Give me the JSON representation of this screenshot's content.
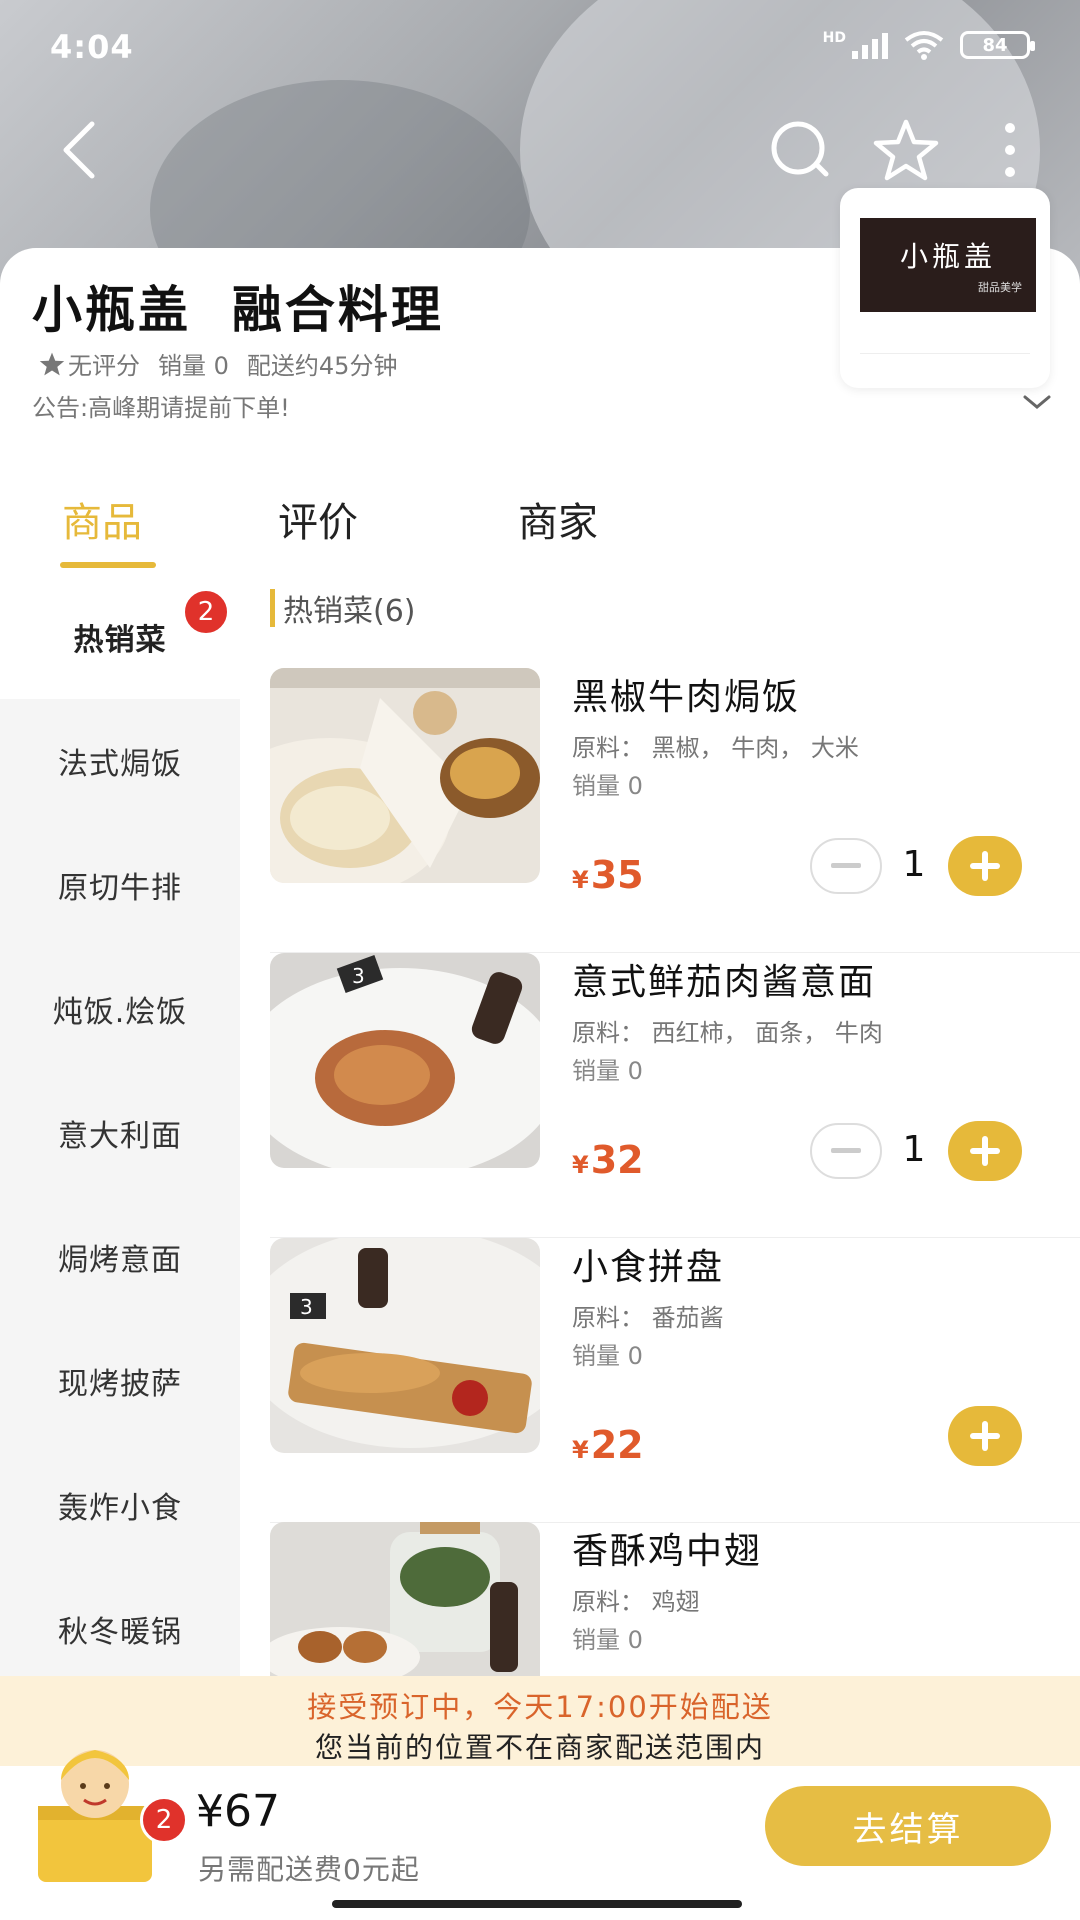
{
  "status_bar": {
    "time": "4:04",
    "network": "HD",
    "battery": "84"
  },
  "nav": {
    "back_icon": "chevron-left-icon",
    "search_icon": "search-icon",
    "favorite_icon": "star-icon",
    "more_icon": "more-vertical-icon"
  },
  "shop": {
    "logo_text": "小瓶盖",
    "logo_subtext": "甜品美学",
    "title": "小瓶盖  融合料理",
    "rating": "无评分",
    "sales": "销量 0",
    "delivery_time": "配送约45分钟",
    "notice": "公告:高峰期请提前下单!"
  },
  "tabs": [
    {
      "label": "商品",
      "active": true
    },
    {
      "label": "评价",
      "active": false
    },
    {
      "label": "商家",
      "active": false
    }
  ],
  "sidebar": {
    "badge": "2",
    "items": [
      {
        "label": "热销菜",
        "active": true
      },
      {
        "label": "法式焗饭",
        "active": false
      },
      {
        "label": "原切牛排",
        "active": false
      },
      {
        "label": "炖饭.烩饭",
        "active": false
      },
      {
        "label": "意大利面",
        "active": false
      },
      {
        "label": "焗烤意面",
        "active": false
      },
      {
        "label": "现烤披萨",
        "active": false
      },
      {
        "label": "轰炸小食",
        "active": false
      },
      {
        "label": "秋冬暖锅",
        "active": false
      }
    ]
  },
  "section": {
    "title": "热销菜(6)"
  },
  "products": [
    {
      "name": "黑椒牛肉焗饭",
      "ingredients": "原料： 黑椒， 牛肉， 大米",
      "sales": "销量 0",
      "currency": "¥",
      "price": "35",
      "quantity": "1"
    },
    {
      "name": "意式鲜茄肉酱意面",
      "ingredients": "原料： 西红柿， 面条， 牛肉",
      "sales": "销量 0",
      "currency": "¥",
      "price": "32",
      "quantity": "1"
    },
    {
      "name": "小食拼盘",
      "ingredients": "原料： 番茄酱",
      "sales": "销量 0",
      "currency": "¥",
      "price": "22",
      "quantity": ""
    },
    {
      "name": "香酥鸡中翅",
      "ingredients": "原料： 鸡翅",
      "sales": "销量 0",
      "currency": "¥",
      "price": "",
      "quantity": ""
    }
  ],
  "banner": {
    "line1": "接受预订中，今天17:00开始配送",
    "line2": "您当前的位置不在商家配送范围内"
  },
  "cart": {
    "badge": "2",
    "total": "¥67",
    "delivery_note": "另需配送费0元起",
    "checkout_label": "去结算"
  },
  "colors": {
    "accent": "#e6b93a",
    "price": "#e05a2b",
    "badge": "#e0322b",
    "banner_bg": "#fdf1d8"
  }
}
